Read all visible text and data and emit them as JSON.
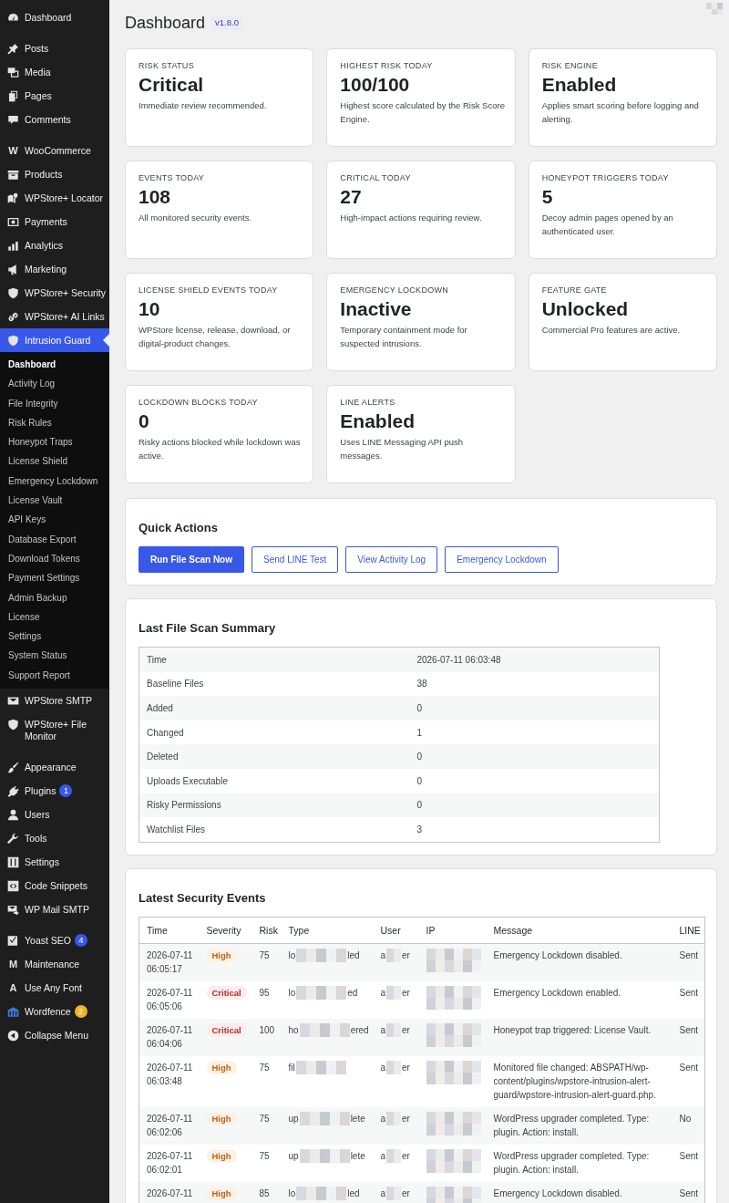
{
  "sidebar": {
    "groups": [
      {
        "items": [
          {
            "label": "Dashboard",
            "selected": false
          }
        ]
      },
      {
        "items": [
          {
            "label": "Posts",
            "selected": false
          },
          {
            "label": "Media",
            "selected": false
          },
          {
            "label": "Pages",
            "selected": false
          },
          {
            "label": "Comments",
            "selected": false
          }
        ]
      },
      {
        "items": [
          {
            "label": "WooCommerce",
            "icon_text": "W",
            "selected": false
          },
          {
            "label": "Products",
            "selected": false
          },
          {
            "label": "WPStore+ Locator",
            "selected": false
          },
          {
            "label": "Payments",
            "selected": false
          },
          {
            "label": "Analytics",
            "selected": false
          },
          {
            "label": "Marketing",
            "selected": false
          },
          {
            "label": "WPStore+ Security",
            "selected": false
          },
          {
            "label": "WPStore+ AI Links",
            "selected": false
          },
          {
            "label": "Intrusion Guard",
            "selected": true,
            "children": [
              {
                "label": "Dashboard",
                "selected": true
              },
              {
                "label": "Activity Log",
                "selected": false
              },
              {
                "label": "File Integrity",
                "selected": false
              },
              {
                "label": "Risk Rules",
                "selected": false
              },
              {
                "label": "Honeypot Traps",
                "selected": false
              },
              {
                "label": "License Shield",
                "selected": false
              },
              {
                "label": "Emergency Lockdown",
                "selected": false
              },
              {
                "label": "License Vault",
                "selected": false
              },
              {
                "label": "API Keys",
                "selected": false
              },
              {
                "label": "Database Export",
                "selected": false
              },
              {
                "label": "Download Tokens",
                "selected": false
              },
              {
                "label": "Payment Settings",
                "selected": false
              },
              {
                "label": "Admin Backup",
                "selected": false
              },
              {
                "label": "License",
                "selected": false
              },
              {
                "label": "Settings",
                "selected": false
              },
              {
                "label": "System Status",
                "selected": false
              },
              {
                "label": "Support Report",
                "selected": false
              }
            ]
          },
          {
            "label": "WPStore SMTP",
            "selected": false
          },
          {
            "label": "WPStore+ File Monitor",
            "selected": false
          }
        ]
      },
      {
        "items": [
          {
            "label": "Appearance",
            "selected": false
          },
          {
            "label": "Plugins",
            "selected": false,
            "badge": {
              "text": "1",
              "color": "#3858e9"
            }
          },
          {
            "label": "Users",
            "selected": false
          },
          {
            "label": "Tools",
            "selected": false
          },
          {
            "label": "Settings",
            "selected": false
          },
          {
            "label": "Code Snippets",
            "selected": false
          },
          {
            "label": "WP Mail SMTP",
            "selected": false
          }
        ]
      },
      {
        "items": [
          {
            "label": "Yoast SEO",
            "selected": false,
            "badge": {
              "text": "4",
              "color": "#3858e9"
            }
          },
          {
            "label": "Maintenance",
            "icon_text": "M",
            "selected": false
          },
          {
            "label": "Use Any Font",
            "icon_text": "A",
            "selected": false
          },
          {
            "label": "Wordfence",
            "selected": false,
            "badge": {
              "text": "2",
              "color": "#f0b429"
            }
          },
          {
            "label": "Collapse Menu",
            "selected": false
          }
        ]
      }
    ]
  },
  "header": {
    "title": "Dashboard",
    "version": "v1.8.0"
  },
  "cards": [
    {
      "label": "RISK STATUS",
      "value": "Critical",
      "description": "Immediate review recommended."
    },
    {
      "label": "HIGHEST RISK TODAY",
      "value": "100/100",
      "description": "Highest score calculated by the Risk Score Engine."
    },
    {
      "label": "RISK ENGINE",
      "value": "Enabled",
      "description": "Applies smart scoring before logging and alerting."
    },
    {
      "label": "EVENTS TODAY",
      "value": "108",
      "description": "All monitored security events."
    },
    {
      "label": "CRITICAL TODAY",
      "value": "27",
      "description": "High-impact actions requiring review."
    },
    {
      "label": "HONEYPOT TRIGGERS TODAY",
      "value": "5",
      "description": "Decoy admin pages opened by an authenticated user."
    },
    {
      "label": "LICENSE SHIELD EVENTS TODAY",
      "value": "10",
      "description": "WPStore license, release, download, or digital-product changes."
    },
    {
      "label": "EMERGENCY LOCKDOWN",
      "value": "Inactive",
      "description": "Temporary containment mode for suspected intrusions."
    },
    {
      "label": "FEATURE GATE",
      "value": "Unlocked",
      "description": "Commercial Pro features are active."
    },
    {
      "label": "LOCKDOWN BLOCKS TODAY",
      "value": "0",
      "description": "Risky actions blocked while lockdown was active."
    },
    {
      "label": "LINE ALERTS",
      "value": "Enabled",
      "description": "Uses LINE Messaging API push messages."
    }
  ],
  "quick_actions": {
    "title": "Quick Actions",
    "buttons": [
      {
        "label": "Run File Scan Now",
        "kind": "primary"
      },
      {
        "label": "Send LINE Test",
        "kind": "secondary"
      },
      {
        "label": "View Activity Log",
        "kind": "secondary"
      },
      {
        "label": "Emergency Lockdown",
        "kind": "secondary"
      }
    ]
  },
  "file_scan": {
    "title": "Last File Scan Summary",
    "rows": [
      {
        "label": "Time",
        "value": "2026-07-11 06:03:48"
      },
      {
        "label": "Baseline Files",
        "value": "38"
      },
      {
        "label": "Added",
        "value": "0"
      },
      {
        "label": "Changed",
        "value": "1"
      },
      {
        "label": "Deleted",
        "value": "0"
      },
      {
        "label": "Uploads Executable",
        "value": "0"
      },
      {
        "label": "Risky Permissions",
        "value": "0"
      },
      {
        "label": "Watchlist Files",
        "value": "3"
      }
    ]
  },
  "events": {
    "title": "Latest Security Events",
    "columns": [
      "Time",
      "Severity",
      "Risk",
      "Type",
      "User",
      "IP",
      "Message",
      "LINE"
    ],
    "rows": [
      {
        "time": "2026-07-11 06:05:17",
        "severity": "High",
        "kind": "high",
        "risk": "75",
        "type_start": "lo",
        "type_end": "led",
        "user_start": "a",
        "user_end": "er",
        "message": "Emergency Lockdown disabled.",
        "line": "Sent"
      },
      {
        "time": "2026-07-11 06:05:06",
        "severity": "Critical",
        "kind": "critical",
        "risk": "95",
        "type_start": "lo",
        "type_end": "ed",
        "user_start": "a",
        "user_end": "er",
        "message": "Emergency Lockdown enabled.",
        "line": "Sent"
      },
      {
        "time": "2026-07-11 06:04:06",
        "severity": "Critical",
        "kind": "critical",
        "risk": "100",
        "type_start": "ho",
        "type_end": "ered",
        "user_start": "a",
        "user_end": "er",
        "message": "Honeypot trap triggered: License Vault.",
        "line": "Sent"
      },
      {
        "time": "2026-07-11 06:03:48",
        "severity": "High",
        "kind": "high",
        "risk": "75",
        "type_start": "fil",
        "user_start": "a",
        "user_end": "er",
        "message": "Monitored file changed: ABSPATH/wp-content/plugins/wpstore-intrusion-alert-guard/wpstore-intrusion-alert-guard.php.",
        "line": "Sent"
      },
      {
        "time": "2026-07-11 06:02:06",
        "severity": "High",
        "kind": "high",
        "risk": "75",
        "type_start": "up",
        "type_end": "lete",
        "user_start": "a",
        "user_end": "er",
        "message": "WordPress upgrader completed. Type: plugin. Action: install.",
        "line": "No"
      },
      {
        "time": "2026-07-11 06:02:01",
        "severity": "High",
        "kind": "high",
        "risk": "75",
        "type_start": "up",
        "type_end": "lete",
        "user_start": "a",
        "user_end": "er",
        "message": "WordPress upgrader completed. Type: plugin. Action: install.",
        "line": "Sent"
      },
      {
        "time": "2026-07-11",
        "severity": "High",
        "kind": "high",
        "risk": "85",
        "type_start": "lo",
        "type_end": "led",
        "user_start": "a",
        "user_end": "er",
        "message": "Emergency Lockdown disabled.",
        "line": "Sent"
      }
    ]
  }
}
